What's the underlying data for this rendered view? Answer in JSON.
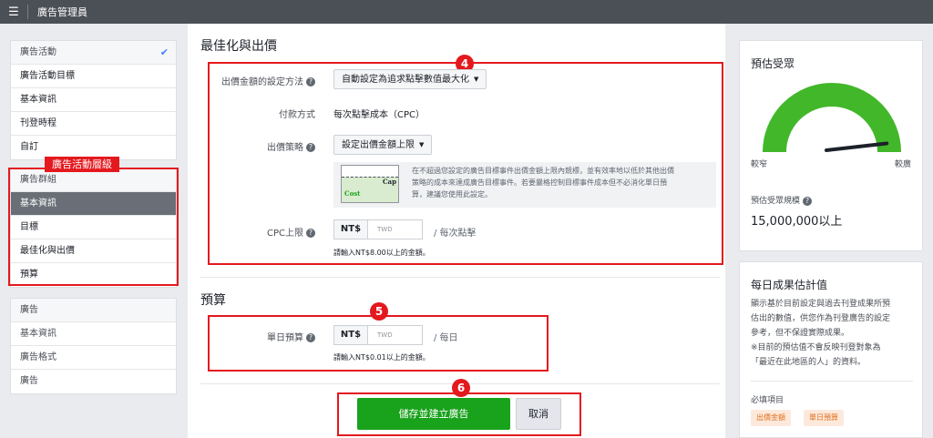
{
  "app": {
    "title": "廣告管理員"
  },
  "sidebar": {
    "campaign_group": [
      {
        "label": "廣告活動",
        "checked": true
      },
      {
        "label": "廣告活動目標"
      },
      {
        "label": "基本資訊"
      },
      {
        "label": "刊登時程"
      },
      {
        "label": "自訂"
      }
    ],
    "adset_label": "廣告活動層級",
    "adset_group": [
      {
        "label": "廣告群組"
      },
      {
        "label": "基本資訊"
      },
      {
        "label": "目標"
      },
      {
        "label": "最佳化與出價"
      },
      {
        "label": "預算"
      }
    ],
    "ad_group": [
      {
        "label": "廣告"
      },
      {
        "label": "基本資訊"
      },
      {
        "label": "廣告格式"
      },
      {
        "label": "廣告"
      }
    ]
  },
  "optimization": {
    "title": "最佳化與出價",
    "badge": "4",
    "bid_method_label": "出價金額的設定方法",
    "bid_method_value": "自動設定為追求點擊數值最大化",
    "payment_label": "付款方式",
    "payment_value": "每次點擊成本（CPC）",
    "strategy_label": "出價策略",
    "strategy_value": "設定出價金額上限",
    "cap_label": "Cap",
    "cost_label": "Cost",
    "strategy_info": [
      "在不超過您設定的廣告目標事件出價金額上限內競標，並有效率地以低於其他出價",
      "策略的成本來達成廣告目標事件。若要嚴格控制目標事件成本但不必消化單日預",
      "算，建議您使用此設定。"
    ],
    "cpc_label": "CPC上限",
    "currency": "NT$",
    "cpc_placeholder": "TWD",
    "cpc_suffix": "/ 每次點擊",
    "cpc_hint": "請輸入NT$8.00以上的金額。"
  },
  "budget": {
    "title": "預算",
    "badge": "5",
    "daily_label": "單日預算",
    "currency": "NT$",
    "placeholder": "TWD",
    "suffix": "/ 每日",
    "hint": "請輸入NT$0.01以上的金額。"
  },
  "actions": {
    "badge": "6",
    "save": "儲存並建立廣告",
    "cancel": "取消"
  },
  "audience": {
    "title": "預估受眾",
    "narrow": "較窄",
    "broad": "較廣",
    "gauge_level": 0.95,
    "size_label": "預估受眾規模",
    "size_value": "15,000,000以上"
  },
  "daily_results": {
    "title": "每日成果估計值",
    "desc": [
      "顯示基於目前設定與過去刊登成果所預",
      "估出的數值，供您作為刊登廣告的設定",
      "參考，但不保證實際成果。",
      "※目前的預估值不會反映刊登對象為",
      "「最近在此地區的人」的資料。"
    ],
    "required_label": "必填項目",
    "tags": [
      "出價金額",
      "單日預算"
    ]
  },
  "colors": {
    "accent": "#19a21c",
    "highlight": "#e4191e",
    "topbar": "#4b4f56"
  }
}
